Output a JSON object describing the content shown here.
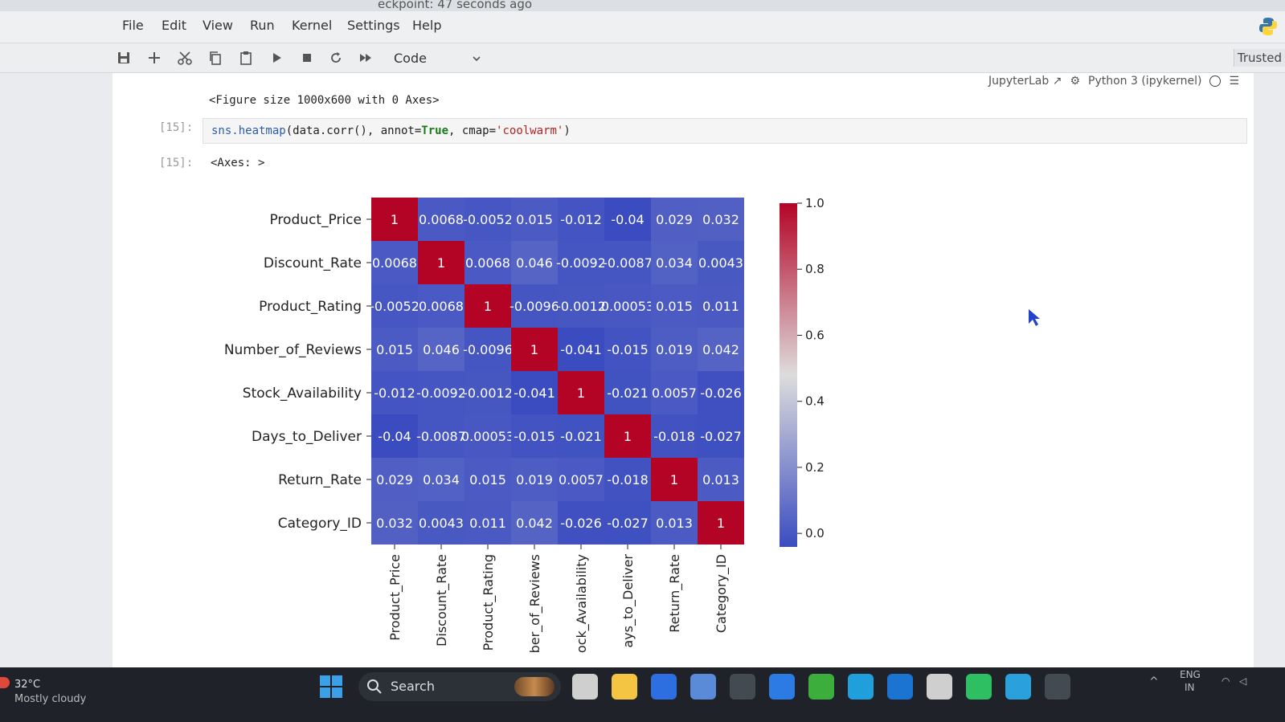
{
  "window": {
    "partial_title": "eckpoint: 47 seconds ago"
  },
  "menubar": {
    "items": [
      "File",
      "Edit",
      "View",
      "Run",
      "Kernel",
      "Settings",
      "Help"
    ]
  },
  "toolbar": {
    "cell_type": "Code",
    "trusted_label": "Trusted",
    "icons": [
      "save-icon",
      "add-cell-icon",
      "cut-icon",
      "copy-icon",
      "paste-icon",
      "run-icon",
      "stop-icon",
      "restart-icon",
      "run-all-icon"
    ]
  },
  "kernel": {
    "jupyterlab_label": "JupyterLab",
    "kernel_name": "Python 3 (ipykernel)"
  },
  "cells": {
    "prev_output": "<Figure size 1000x600 with 0 Axes>",
    "input_prompt": "[15]:",
    "code_fn": "sns.heatmap",
    "code_mid": "(data.corr(), annot=",
    "code_true": "True",
    "code_comma": ", cmap=",
    "code_str": "'coolwarm'",
    "code_end": ")",
    "output_prompt": "[15]:",
    "output_text": "<Axes: >"
  },
  "chart_data": {
    "type": "heatmap",
    "cmap": "coolwarm",
    "labels": [
      "Product_Price",
      "Discount_Rate",
      "Product_Rating",
      "Number_of_Reviews",
      "Stock_Availability",
      "Days_to_Deliver",
      "Return_Rate",
      "Category_ID"
    ],
    "x_tick_labels_visible": [
      "Product_Price",
      "Discount_Rate",
      "Product_Rating",
      "ber_of_Reviews",
      "ock_Availability",
      "ays_to_Deliver",
      "Return_Rate",
      "Category_ID"
    ],
    "values": [
      [
        1,
        0.0068,
        -0.0052,
        0.015,
        -0.012,
        -0.04,
        0.029,
        0.032
      ],
      [
        0.0068,
        1,
        0.0068,
        0.046,
        -0.0092,
        -0.0087,
        0.034,
        0.0043
      ],
      [
        -0.0052,
        0.0068,
        1,
        -0.0096,
        -0.0012,
        0.00053,
        0.015,
        0.011
      ],
      [
        0.015,
        0.046,
        -0.0096,
        1,
        -0.041,
        -0.015,
        0.019,
        0.042
      ],
      [
        -0.012,
        -0.0092,
        -0.0012,
        -0.041,
        1,
        -0.021,
        0.0057,
        -0.026
      ],
      [
        -0.04,
        -0.0087,
        0.00053,
        -0.015,
        -0.021,
        1,
        -0.018,
        -0.027
      ],
      [
        0.029,
        0.034,
        0.015,
        0.019,
        0.0057,
        -0.018,
        1,
        0.013
      ],
      [
        0.032,
        0.0043,
        0.011,
        0.042,
        -0.026,
        -0.027,
        0.013,
        1
      ]
    ],
    "annotations": [
      [
        "1",
        "0.0068",
        "-0.0052",
        "0.015",
        "-0.012",
        "-0.04",
        "0.029",
        "0.032"
      ],
      [
        "0.0068",
        "1",
        "0.0068",
        "0.046",
        "-0.0092",
        "-0.0087",
        "0.034",
        "0.0043"
      ],
      [
        "-0.0052",
        "0.0068",
        "1",
        "-0.0096",
        "-0.0012",
        "0.00053",
        "0.015",
        "0.011"
      ],
      [
        "0.015",
        "0.046",
        "-0.0096",
        "1",
        "-0.041",
        "-0.015",
        "0.019",
        "0.042"
      ],
      [
        "-0.012",
        "-0.0092",
        "-0.0012",
        "-0.041",
        "1",
        "-0.021",
        "0.0057",
        "-0.026"
      ],
      [
        "-0.04",
        "-0.0087",
        "0.00053",
        "-0.015",
        "-0.021",
        "1",
        "-0.018",
        "-0.027"
      ],
      [
        "0.029",
        "0.034",
        "0.015",
        "0.019",
        "0.0057",
        "-0.018",
        "1",
        "0.013"
      ],
      [
        "0.032",
        "0.0043",
        "0.011",
        "0.042",
        "-0.026",
        "-0.027",
        "0.013",
        "1"
      ]
    ],
    "colorbar": {
      "range": [
        -0.041,
        1.0
      ],
      "ticks": [
        0.0,
        0.2,
        0.4,
        0.6,
        0.8,
        1.0
      ],
      "tick_labels": [
        "0.0",
        "0.2",
        "0.4",
        "0.6",
        "0.8",
        "1.0"
      ]
    },
    "colors": {
      "low": "#3b4cc0",
      "mid": "#dddcdc",
      "high": "#b40426"
    }
  },
  "taskbar": {
    "temperature": "32°C",
    "weather": "Mostly cloudy",
    "search_label": "Search",
    "lang": "ENG",
    "region": "IN",
    "apps": [
      "task-view-icon",
      "file-explorer-icon",
      "mail-app-icon",
      "store-icon",
      "github-icon",
      "vscode-icon",
      "xbox-icon",
      "edge-icon",
      "outlook-icon",
      "chatgpt-icon",
      "whatsapp-icon",
      "telegram-icon",
      "terminal-icon"
    ],
    "app_colors": [
      "#cfcfcf",
      "#f4c542",
      "#2d6fe0",
      "#5a8bd8",
      "#444a52",
      "#2c7be5",
      "#3cae3c",
      "#1fa0dd",
      "#1b73d2",
      "#cfcfcf",
      "#2fbf63",
      "#2aa1dd",
      "#444a52"
    ]
  }
}
